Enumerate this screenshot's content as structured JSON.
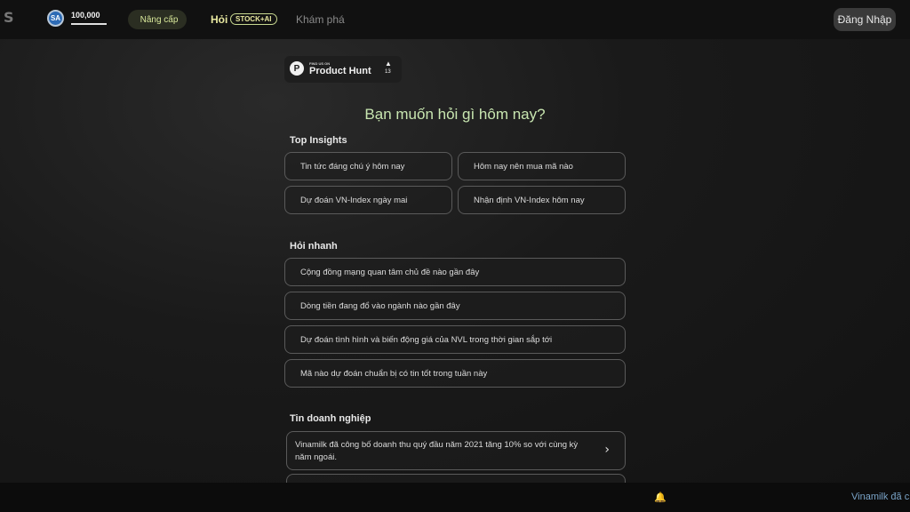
{
  "header": {
    "logo": "S",
    "avatar_initials": "SA",
    "points": "100,000",
    "upgrade_icon": "",
    "upgrade_label": "Nâng cấp",
    "nav_ask": "Hỏi",
    "nav_badge": "STOCK+AI",
    "nav_explore": "Khám phá",
    "login_label": "Đăng Nhập"
  },
  "product_hunt": {
    "logo_letter": "P",
    "small_text": "FIND US ON",
    "name": "Product Hunt",
    "arrow": "▲",
    "count": "13"
  },
  "hero": {
    "title": "Bạn muốn hỏi gì hôm nay?"
  },
  "top_insights": {
    "icon": "",
    "title": "Top Insights",
    "items": [
      {
        "icon": "",
        "label": "Tin tức đáng chú ý hôm nay"
      },
      {
        "icon": "",
        "label": "Hôm nay nên mua mã nào"
      },
      {
        "icon": "",
        "label": "Dự đoán VN-Index ngày mai"
      },
      {
        "icon": "",
        "label": "Nhận định VN-Index hôm nay"
      }
    ]
  },
  "quick_ask": {
    "icon": "",
    "title": "Hỏi nhanh",
    "items": [
      {
        "icon": "",
        "label": "Cộng đồng mạng quan tâm chủ đề nào gần đây"
      },
      {
        "icon": "",
        "label": "Dòng tiền đang đổ vào ngành nào gần đây"
      },
      {
        "icon": "",
        "label": "Dự đoán tình hình và biến động giá của NVL trong thời gian sắp tới"
      },
      {
        "icon": "",
        "label": "Mã nào dự đoán chuẩn bị có tin tốt trong tuần này"
      }
    ]
  },
  "company_news": {
    "icon": "",
    "title": "Tin doanh nghiệp",
    "items": [
      {
        "text": "Vinamilk đã công bố doanh thu quý đầu năm 2021 tăng 10% so với cùng kỳ năm ngoái."
      }
    ],
    "chevron": "›"
  },
  "footer": {
    "bell_icon": "🔔",
    "ticker": "Vinamilk đã c"
  }
}
